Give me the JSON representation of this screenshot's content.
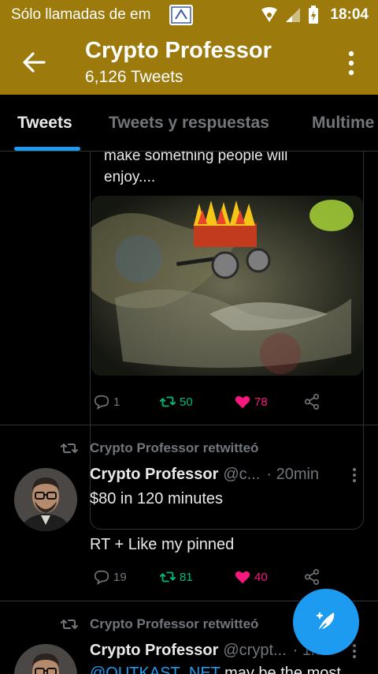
{
  "status_bar": {
    "notification_text": "Sólo llamadas de em",
    "time": "18:04",
    "icons": [
      "app-notification-icon",
      "hotspot-icon",
      "signal-icon",
      "battery-icon"
    ]
  },
  "header": {
    "title": "Crypto Professor",
    "subtitle": "6,126 Tweets"
  },
  "tabs": [
    "Tweets",
    "Tweets y respuestas",
    "Multime"
  ],
  "active_tab": "Tweets",
  "tweets": [
    {
      "quote_text_line1": "make something people will",
      "quote_text_line2": "enjoy....",
      "replies": "1",
      "retweets": "50",
      "likes": "78"
    },
    {
      "retweeted_by": "Crypto Professor retwitteó",
      "name": "Crypto Professor",
      "handle": "@c...",
      "time": "· 20min",
      "line1": "$80 in 120 minutes",
      "line2": "RT + Like my pinned",
      "replies": "19",
      "retweets": "81",
      "likes": "40"
    },
    {
      "retweeted_by": "Crypto Professor retwitteó",
      "name": "Crypto Professor",
      "handle": "@crypt...",
      "time": "· 1h",
      "mention": "@OUTKAST_NET",
      "rest": " may be the most"
    }
  ],
  "colors": {
    "header_bg": "#9c7a0c",
    "accent": "#1d9bf0",
    "retweet": "#00ba7c",
    "like": "#f91880"
  }
}
